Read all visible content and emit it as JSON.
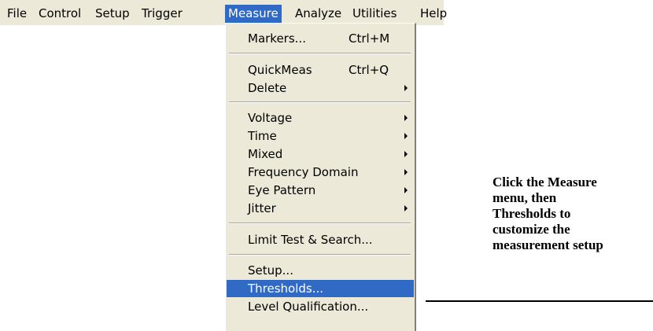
{
  "menubar": {
    "items": [
      "File",
      "Control",
      "Setup",
      "Trigger",
      "Measure",
      "Analyze",
      "Utilities",
      "Help"
    ],
    "active": "Measure"
  },
  "measure_menu": {
    "markers": {
      "label": "Markers...",
      "shortcut": "Ctrl+M"
    },
    "quickmeas": {
      "label": "QuickMeas",
      "shortcut": "Ctrl+Q"
    },
    "delete": {
      "label": "Delete"
    },
    "voltage": {
      "label": "Voltage"
    },
    "time": {
      "label": "Time"
    },
    "mixed": {
      "label": "Mixed"
    },
    "frequency_domain": {
      "label": "Frequency Domain"
    },
    "eye_pattern": {
      "label": "Eye Pattern"
    },
    "jitter": {
      "label": "Jitter"
    },
    "limit_test": {
      "label": "Limit Test & Search..."
    },
    "setup": {
      "label": "Setup..."
    },
    "thresholds": {
      "label": "Thresholds..."
    },
    "level_qualification": {
      "label": "Level Qualification..."
    }
  },
  "callout": {
    "lines": [
      "Click the Measure",
      "menu,  then",
      "Thresholds to",
      "customize the",
      "measurement setup"
    ]
  },
  "colors": {
    "menu_bg": "#ece9d8",
    "highlight": "#316ac5"
  }
}
